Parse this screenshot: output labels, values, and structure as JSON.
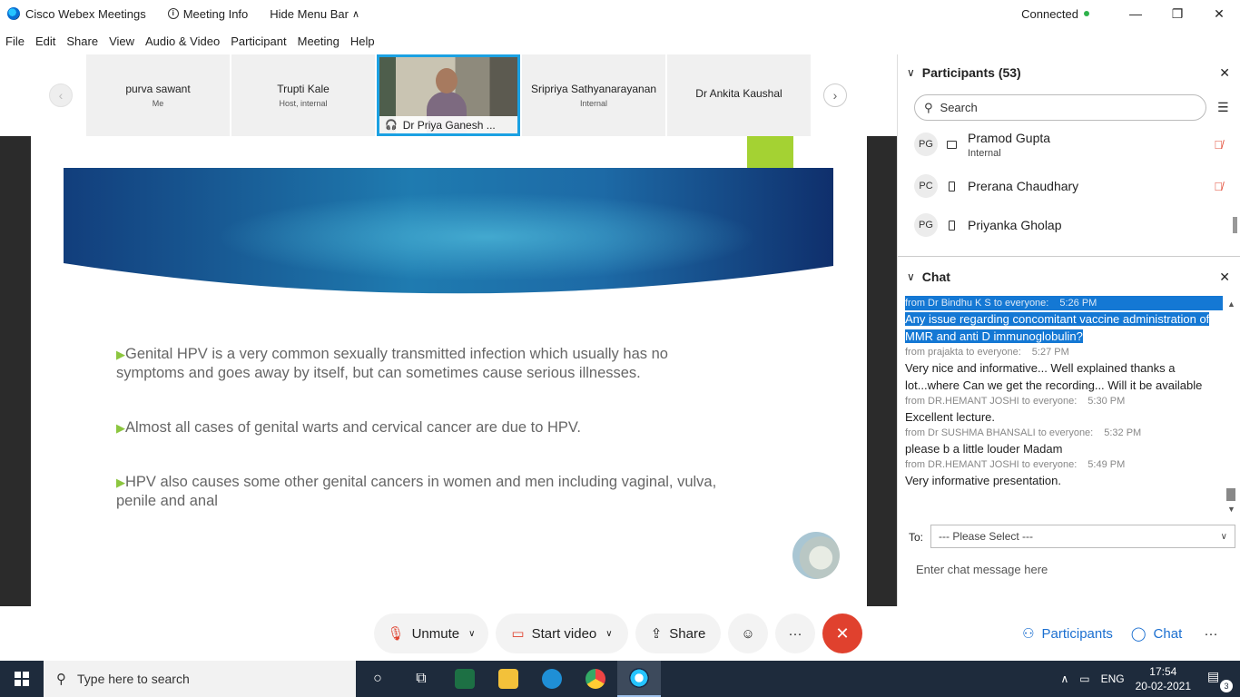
{
  "window": {
    "title": "Cisco Webex Meetings",
    "meeting_info": "Meeting Info",
    "hide_menu": "Hide Menu Bar",
    "status": "Connected",
    "status_color": "#2fb24c"
  },
  "menu": [
    "File",
    "Edit",
    "Share",
    "View",
    "Audio & Video",
    "Participant",
    "Meeting",
    "Help"
  ],
  "video_strip": {
    "tiles": [
      {
        "name": "purva sawant",
        "sub": "Me"
      },
      {
        "name": "Trupti Kale",
        "sub": "Host, internal"
      },
      {
        "name": "Dr Priya Ganesh ...",
        "sub": ""
      },
      {
        "name": "Sripriya Sathyanarayanan",
        "sub": "Internal"
      },
      {
        "name": "Dr Ankita Kaushal",
        "sub": ""
      }
    ]
  },
  "slide": {
    "bullets": [
      "Genital HPV is a very common sexually transmitted infection which usually has no symptoms and goes away by itself, but can sometimes cause serious illnesses.",
      "Almost all cases of genital warts and cervical cancer are due to HPV.",
      "HPV also causes some other genital cancers in women and men including vaginal, vulva, penile and anal"
    ],
    "accent_color": "#a4d233"
  },
  "participants": {
    "header": "Participants (53)",
    "search_placeholder": "Search",
    "list": [
      {
        "initials": "PG",
        "name": "Pramod Gupta",
        "sub": "Internal"
      },
      {
        "initials": "PC",
        "name": "Prerana Chaudhary",
        "sub": ""
      },
      {
        "initials": "PG",
        "name": "Priyanka Gholap",
        "sub": ""
      }
    ]
  },
  "chat": {
    "header": "Chat",
    "messages": [
      {
        "from": "from Dr Bindhu K S to everyone:",
        "time": "5:26 PM",
        "text": "Any issue regarding concomitant vaccine administration of MMR and anti D immunoglobulin?"
      },
      {
        "from": "from prajakta to everyone:",
        "time": "5:27 PM",
        "text": "Very nice and informative... Well explained thanks a lot...where Can we get the recording... Will it be available"
      },
      {
        "from": "from DR.HEMANT JOSHI to everyone:",
        "time": "5:30 PM",
        "text": "Excellent lecture."
      },
      {
        "from": "from Dr SUSHMA BHANSALI to everyone:",
        "time": "5:32 PM",
        "text": "please b a little louder Madam"
      },
      {
        "from": "from DR.HEMANT JOSHI to everyone:",
        "time": "5:49 PM",
        "text": "Very informative presentation."
      }
    ],
    "to_label": "To:",
    "to_value": "--- Please Select ---",
    "input_placeholder": "Enter chat message here"
  },
  "controls": {
    "unmute": "Unmute",
    "start_video": "Start video",
    "share": "Share",
    "participants": "Participants",
    "chat": "Chat",
    "end_color": "#e0412e",
    "accent_color": "#1b6fd0"
  },
  "taskbar": {
    "search_placeholder": "Type here to search",
    "language": "ENG",
    "time": "17:54",
    "date": "20-02-2021",
    "notifications": "3"
  }
}
